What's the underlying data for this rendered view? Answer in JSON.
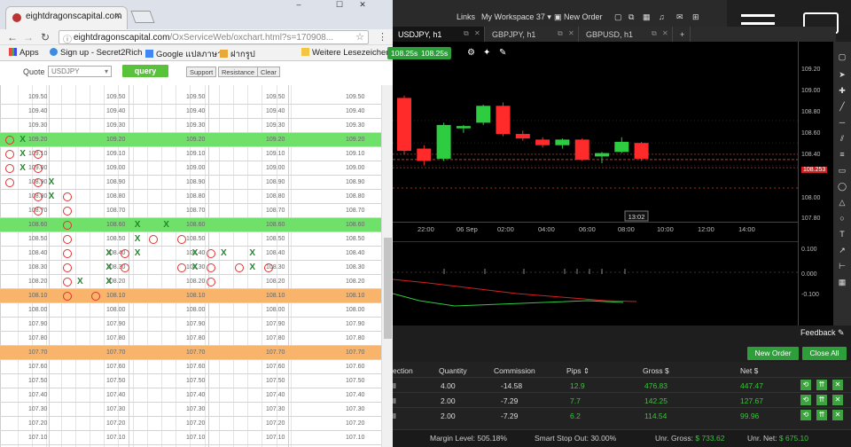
{
  "browser": {
    "tab_title": "eightdragonscapital.com",
    "close_tab_icon": "✕",
    "window_controls": {
      "minimize": "–",
      "maximize": "☐",
      "close": "✕"
    },
    "address": "eightdragonscapital.com",
    "address_path": "/OxServiceWeb/oxchart.html?s=170908...",
    "bookmarks": [
      "Apps",
      "Sign up - Secret2Rich",
      "Google แปลภาษา",
      "ฝากรูป",
      "Weitere Lesezeichen"
    ]
  },
  "query_bar": {
    "quote_label": "Quote",
    "symbol_value": "USDJPY",
    "query_label": "query",
    "support_label": "Support",
    "resistance_label": "Resistance",
    "clear_label": "Clear"
  },
  "pf_grid": {
    "rows": [
      {
        "price": "109.50",
        "band": "none"
      },
      {
        "price": "109.40",
        "band": "none"
      },
      {
        "price": "109.30",
        "band": "none"
      },
      {
        "price": "109.20",
        "band": "green"
      },
      {
        "price": "109.10",
        "band": "none"
      },
      {
        "price": "109.00",
        "band": "none"
      },
      {
        "price": "108.90",
        "band": "none"
      },
      {
        "price": "108.80",
        "band": "none"
      },
      {
        "price": "108.70",
        "band": "none"
      },
      {
        "price": "108.60",
        "band": "green"
      },
      {
        "price": "108.50",
        "band": "none"
      },
      {
        "price": "108.40",
        "band": "none"
      },
      {
        "price": "108.30",
        "band": "none"
      },
      {
        "price": "108.20",
        "band": "none"
      },
      {
        "price": "108.10",
        "band": "orange"
      },
      {
        "price": "108.00",
        "band": "none"
      },
      {
        "price": "107.90",
        "band": "none"
      },
      {
        "price": "107.80",
        "band": "none"
      },
      {
        "price": "107.70",
        "band": "orange"
      },
      {
        "price": "107.60",
        "band": "none"
      },
      {
        "price": "107.50",
        "band": "none"
      },
      {
        "price": "107.40",
        "band": "none"
      },
      {
        "price": "107.30",
        "band": "none"
      },
      {
        "price": "107.20",
        "band": "none"
      },
      {
        "price": "107.10",
        "band": "none"
      }
    ],
    "marks": [
      {
        "row": 3,
        "col": 0,
        "t": "O"
      },
      {
        "row": 3,
        "col": 1,
        "t": "X"
      },
      {
        "row": 4,
        "col": 0,
        "t": "O"
      },
      {
        "row": 4,
        "col": 1,
        "t": "X"
      },
      {
        "row": 4,
        "col": 2,
        "t": "O"
      },
      {
        "row": 5,
        "col": 0,
        "t": "O"
      },
      {
        "row": 5,
        "col": 1,
        "t": "X"
      },
      {
        "row": 5,
        "col": 2,
        "t": "O"
      },
      {
        "row": 6,
        "col": 0,
        "t": "O"
      },
      {
        "row": 6,
        "col": 2,
        "t": "O"
      },
      {
        "row": 6,
        "col": 3,
        "t": "X"
      },
      {
        "row": 7,
        "col": 2,
        "t": "O"
      },
      {
        "row": 7,
        "col": 3,
        "t": "X"
      },
      {
        "row": 7,
        "col": 4,
        "t": "O"
      },
      {
        "row": 8,
        "col": 2,
        "t": "O"
      },
      {
        "row": 8,
        "col": 4,
        "t": "O"
      },
      {
        "row": 9,
        "col": 4,
        "t": "O"
      },
      {
        "row": 9,
        "col": 9,
        "t": "X"
      },
      {
        "row": 9,
        "col": 11,
        "t": "X"
      },
      {
        "row": 10,
        "col": 4,
        "t": "O"
      },
      {
        "row": 10,
        "col": 9,
        "t": "X"
      },
      {
        "row": 10,
        "col": 10,
        "t": "O"
      },
      {
        "row": 10,
        "col": 12,
        "t": "O"
      },
      {
        "row": 11,
        "col": 4,
        "t": "O"
      },
      {
        "row": 11,
        "col": 7,
        "t": "X"
      },
      {
        "row": 11,
        "col": 8,
        "t": "O"
      },
      {
        "row": 11,
        "col": 9,
        "t": "X"
      },
      {
        "row": 11,
        "col": 13,
        "t": "X"
      },
      {
        "row": 11,
        "col": 14,
        "t": "O"
      },
      {
        "row": 11,
        "col": 15,
        "t": "X"
      },
      {
        "row": 11,
        "col": 17,
        "t": "X"
      },
      {
        "row": 12,
        "col": 4,
        "t": "O"
      },
      {
        "row": 12,
        "col": 7,
        "t": "X"
      },
      {
        "row": 12,
        "col": 8,
        "t": "O"
      },
      {
        "row": 12,
        "col": 12,
        "t": "O"
      },
      {
        "row": 12,
        "col": 13,
        "t": "X"
      },
      {
        "row": 12,
        "col": 14,
        "t": "O"
      },
      {
        "row": 12,
        "col": 16,
        "t": "O"
      },
      {
        "row": 12,
        "col": 17,
        "t": "X"
      },
      {
        "row": 12,
        "col": 18,
        "t": "O"
      },
      {
        "row": 13,
        "col": 4,
        "t": "O"
      },
      {
        "row": 13,
        "col": 5,
        "t": "X"
      },
      {
        "row": 13,
        "col": 7,
        "t": "X"
      },
      {
        "row": 13,
        "col": 14,
        "t": "O"
      },
      {
        "row": 14,
        "col": 4,
        "t": "O"
      },
      {
        "row": 14,
        "col": 6,
        "t": "O"
      }
    ]
  },
  "topbar": {
    "links_label": "Links",
    "workspace_label": "My Workspace 37",
    "new_order_label": "New Order"
  },
  "chart_tabs": [
    {
      "label": "USDJPY, h1",
      "active": true
    },
    {
      "label": "GBPJPY, h1",
      "active": false
    },
    {
      "label": "GBPUSD, h1",
      "active": false
    },
    {
      "label": "+",
      "active": false
    }
  ],
  "chart": {
    "sell_badge": "108.25s",
    "buy_badge": "108.25s",
    "last_price": "108.253",
    "crosshair_time": "13:02",
    "price_labels": [
      "109.20",
      "109.00",
      "108.80",
      "108.60",
      "108.40",
      "108.253",
      "108.00",
      "107.80"
    ],
    "indicator_labels": [
      "0.100",
      "0.000",
      "-0.100"
    ],
    "time_labels": [
      "22:00",
      "06 Sep",
      "02:00",
      "04:00",
      "06:00",
      "08:00",
      "10:00",
      "12:00",
      "14:00"
    ],
    "colors": {
      "up": "#2ecc40",
      "down": "#ff2a2a",
      "background": "#000000"
    }
  },
  "chart_data": {
    "type": "candlestick",
    "x": [
      "c1",
      "c2",
      "c3",
      "c4",
      "c5",
      "c6",
      "c7",
      "c8",
      "c9",
      "c10",
      "c11",
      "c12"
    ],
    "candles": [
      {
        "o": 108.8,
        "h": 108.82,
        "l": 108.3,
        "c": 108.33,
        "dir": "down"
      },
      {
        "o": 108.35,
        "h": 108.38,
        "l": 108.2,
        "c": 108.24,
        "dir": "down"
      },
      {
        "o": 108.26,
        "h": 108.58,
        "l": 108.24,
        "c": 108.56,
        "dir": "up"
      },
      {
        "o": 108.53,
        "h": 108.56,
        "l": 108.49,
        "c": 108.55,
        "dir": "up"
      },
      {
        "o": 108.58,
        "h": 108.74,
        "l": 108.56,
        "c": 108.73,
        "dir": "up"
      },
      {
        "o": 108.73,
        "h": 108.76,
        "l": 108.46,
        "c": 108.48,
        "dir": "down"
      },
      {
        "o": 108.48,
        "h": 108.51,
        "l": 108.42,
        "c": 108.44,
        "dir": "down"
      },
      {
        "o": 108.43,
        "h": 108.45,
        "l": 108.36,
        "c": 108.38,
        "dir": "down"
      },
      {
        "o": 108.38,
        "h": 108.44,
        "l": 108.35,
        "c": 108.43,
        "dir": "up"
      },
      {
        "o": 108.43,
        "h": 108.44,
        "l": 108.24,
        "c": 108.25,
        "dir": "down"
      },
      {
        "o": 108.28,
        "h": 108.32,
        "l": 108.22,
        "c": 108.31,
        "dir": "up"
      },
      {
        "o": 108.32,
        "h": 108.45,
        "l": 108.31,
        "c": 108.41,
        "dir": "up"
      },
      {
        "o": 108.4,
        "h": 108.41,
        "l": 108.24,
        "c": 108.26,
        "dir": "down"
      }
    ],
    "ylim": [
      107.7,
      109.3
    ]
  },
  "feedback_label": "Feedback",
  "orders": {
    "new_order_label": "New Order",
    "close_all_label": "Close All",
    "headers": [
      "ection",
      "Quantity",
      "Commission",
      "Pips",
      "Gross $",
      "Net $"
    ],
    "rows": [
      {
        "dir": "ll",
        "qty": "4.00",
        "comm": "-14.58",
        "pips": "12.9",
        "gross": "476.83",
        "net": "447.47"
      },
      {
        "dir": "ll",
        "qty": "2.00",
        "comm": "-7.29",
        "pips": "7.7",
        "gross": "142.25",
        "net": "127.67"
      },
      {
        "dir": "ll",
        "qty": "2.00",
        "comm": "-7.29",
        "pips": "6.2",
        "gross": "114.54",
        "net": "99.96"
      }
    ]
  },
  "status": {
    "margin_label": "Margin Level:",
    "margin_value": "505.18%",
    "stop_label": "Smart Stop Out:",
    "stop_value": "30.00%",
    "unr_gross_label": "Unr. Gross:",
    "unr_gross_value": "$ 733.62",
    "unr_net_label": "Unr. Net:",
    "unr_net_value": "$ 675.10"
  }
}
